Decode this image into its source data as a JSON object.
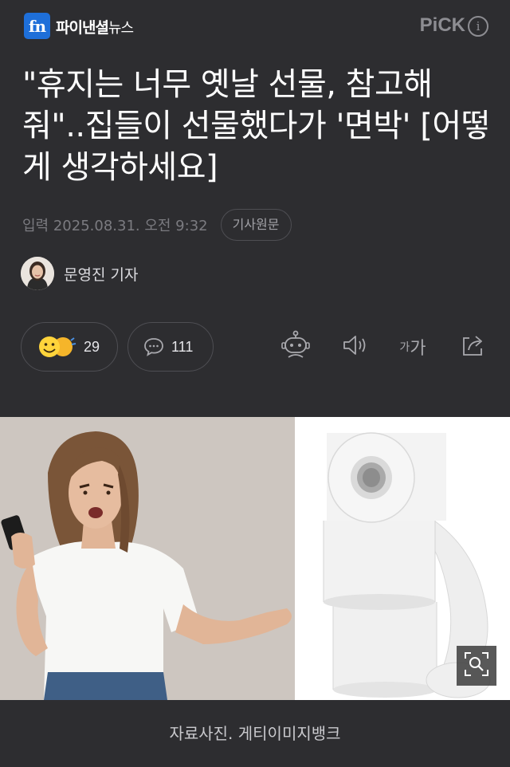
{
  "header": {
    "logo_mark": "fn",
    "logo_name": "파이낸셜",
    "logo_sub": "뉴스",
    "pick_label": "PiCK",
    "info_glyph": "i"
  },
  "article": {
    "title": "\"휴지는 너무 옛날 선물, 참고해 줘\"..집들이 선물했다가 '면박' [어떻게 생각하세요]",
    "date": "입력 2025.08.31. 오전 9:32",
    "origin_label": "기사원문",
    "reporter": "문영진 기자"
  },
  "actions": {
    "like_count": "29",
    "comment_count": "111",
    "font_small": "가",
    "font_large": "가"
  },
  "image": {
    "caption": "자료사진. 게티이미지뱅크"
  },
  "colors": {
    "background": "#2d2d30",
    "logo_blue": "#1e6fd9",
    "muted": "#7b7b80"
  },
  "icons": [
    "emoji-reaction-icon",
    "comment-icon",
    "robot-summary-icon",
    "speaker-icon",
    "share-icon",
    "zoom-icon",
    "info-icon"
  ]
}
